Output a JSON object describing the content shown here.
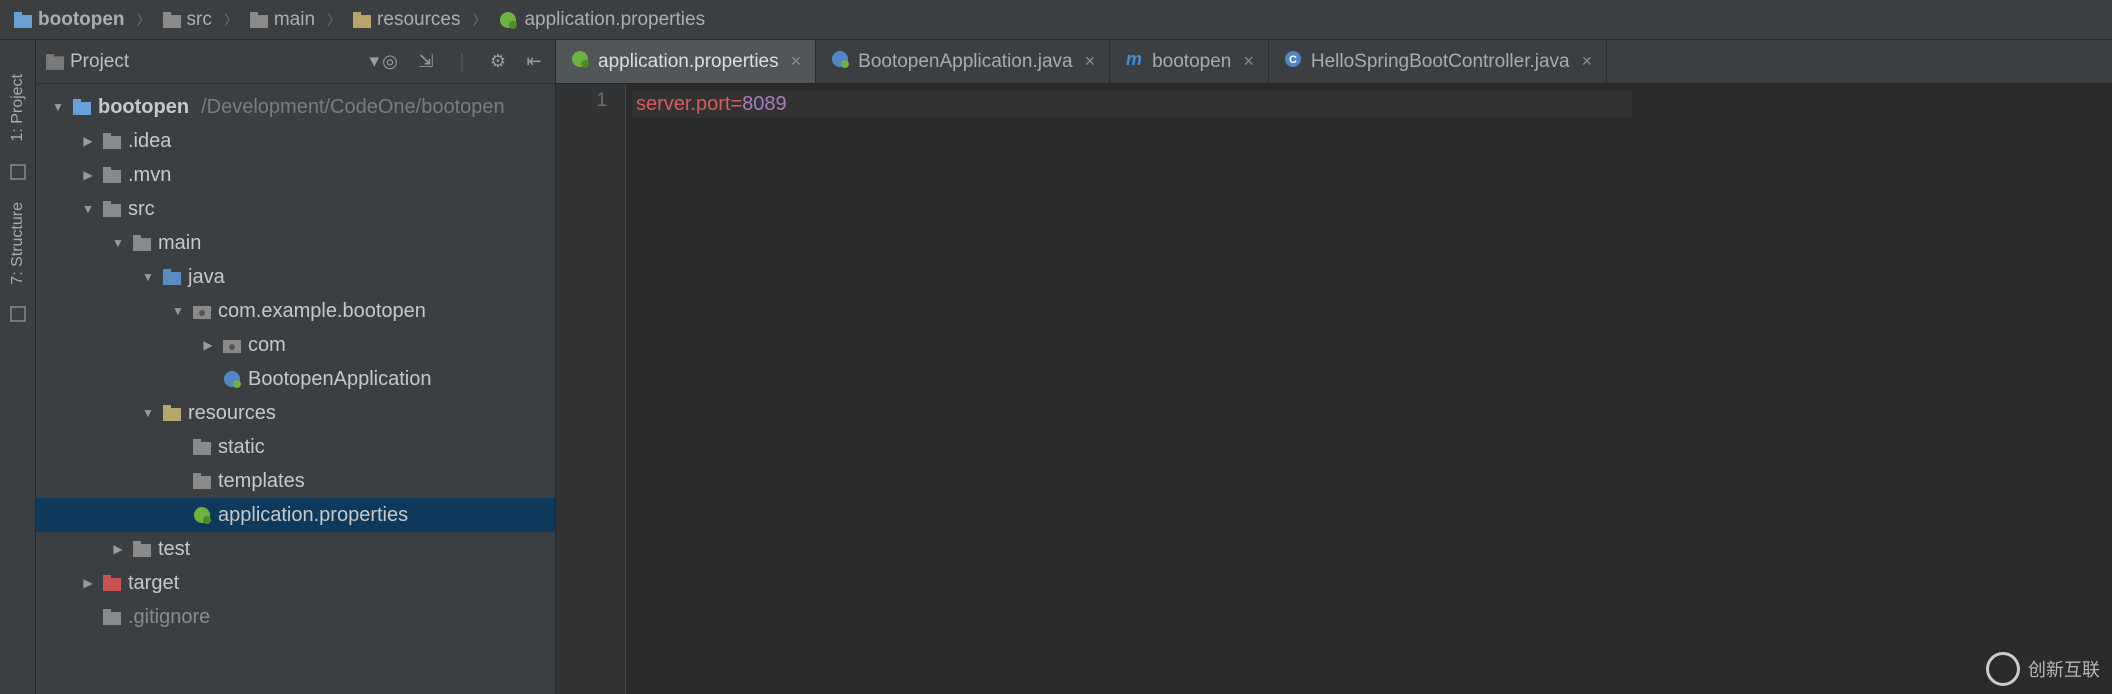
{
  "breadcrumb": [
    {
      "label": "bootopen",
      "icon": "module"
    },
    {
      "label": "src",
      "icon": "folder"
    },
    {
      "label": "main",
      "icon": "folder"
    },
    {
      "label": "resources",
      "icon": "resources"
    },
    {
      "label": "application.properties",
      "icon": "spring-prop"
    }
  ],
  "leftTools": [
    {
      "label": "1: Project",
      "icon": "project"
    },
    {
      "label": "7: Structure",
      "icon": "structure"
    }
  ],
  "sidebar": {
    "title": "Project",
    "dropdown": true
  },
  "tree": {
    "root": {
      "name": "bootopen",
      "path": "/Development/CodeOne/bootopen"
    },
    "items": [
      {
        "indent": 0,
        "arrow": "down",
        "icon": "module",
        "label": "bootopen",
        "path": "/Development/CodeOne/bootopen",
        "root": true
      },
      {
        "indent": 1,
        "arrow": "right",
        "icon": "folder",
        "label": ".idea"
      },
      {
        "indent": 1,
        "arrow": "right",
        "icon": "folder",
        "label": ".mvn"
      },
      {
        "indent": 1,
        "arrow": "down",
        "icon": "folder",
        "label": "src"
      },
      {
        "indent": 2,
        "arrow": "down",
        "icon": "folder",
        "label": "main"
      },
      {
        "indent": 3,
        "arrow": "down",
        "icon": "source-folder",
        "label": "java"
      },
      {
        "indent": 4,
        "arrow": "down",
        "icon": "package",
        "label": "com.example.bootopen"
      },
      {
        "indent": 5,
        "arrow": "right",
        "icon": "package",
        "label": "com"
      },
      {
        "indent": 5,
        "arrow": "",
        "icon": "spring-class",
        "label": "BootopenApplication"
      },
      {
        "indent": 3,
        "arrow": "down",
        "icon": "resources",
        "label": "resources"
      },
      {
        "indent": 4,
        "arrow": "",
        "icon": "folder",
        "label": "static"
      },
      {
        "indent": 4,
        "arrow": "",
        "icon": "folder",
        "label": "templates"
      },
      {
        "indent": 4,
        "arrow": "",
        "icon": "spring-prop",
        "label": "application.properties",
        "selected": true
      },
      {
        "indent": 2,
        "arrow": "right",
        "icon": "folder",
        "label": "test"
      },
      {
        "indent": 1,
        "arrow": "right",
        "icon": "excluded",
        "label": "target"
      },
      {
        "indent": 1,
        "arrow": "",
        "icon": "file",
        "label": ".gitignore",
        "dim": true
      }
    ]
  },
  "tabs": [
    {
      "label": "application.properties",
      "icon": "spring-prop",
      "active": true
    },
    {
      "label": "BootopenApplication.java",
      "icon": "spring-class",
      "active": false
    },
    {
      "label": "bootopen",
      "icon": "maven",
      "active": false
    },
    {
      "label": "HelloSpringBootController.java",
      "icon": "class",
      "active": false
    }
  ],
  "editor": {
    "lineNumber": "1",
    "key": "server.port",
    "eq": "=",
    "value": "8089"
  },
  "watermark": "创新互联"
}
